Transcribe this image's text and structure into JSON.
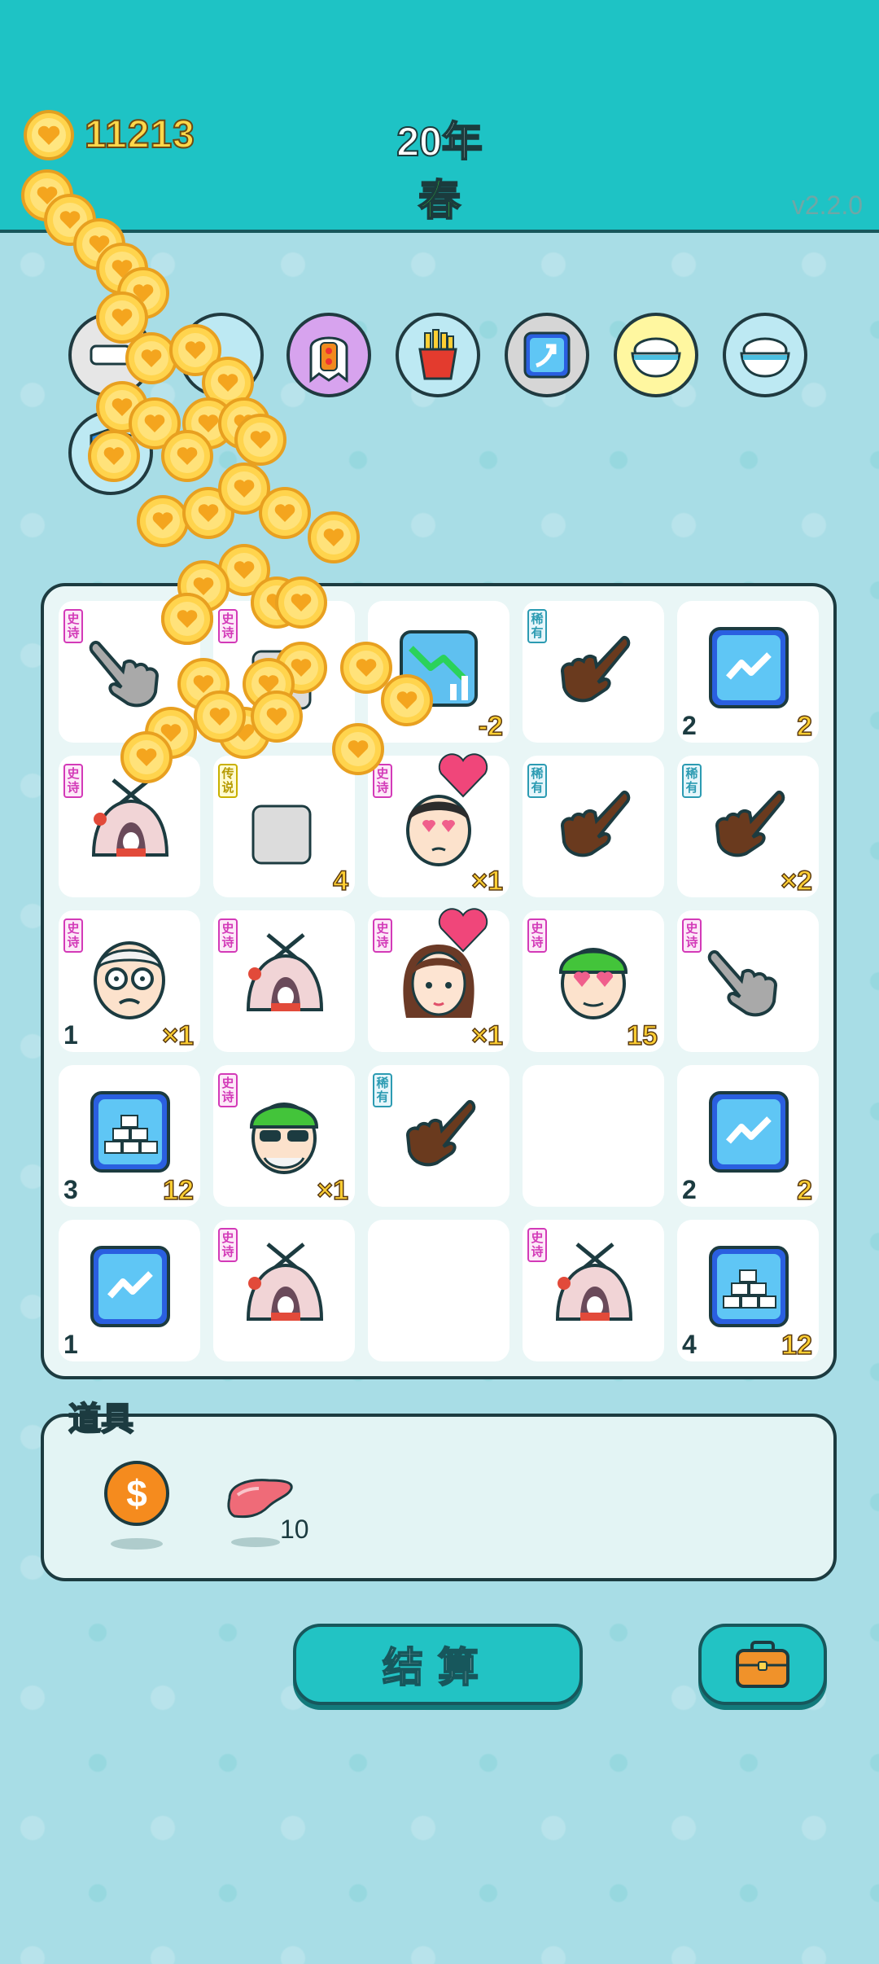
{
  "header": {
    "coins": "11213",
    "year": "20年",
    "season": "春",
    "version": "v2.2.0"
  },
  "items": [
    {
      "name": "dentures-icon",
      "bg": "#e6e6e6"
    },
    {
      "name": "scooter-icon",
      "bg": "#bde9f3"
    },
    {
      "name": "ghost-traffic-light-icon",
      "bg": "#d7a3ee"
    },
    {
      "name": "fries-icon",
      "bg": "#bde9f3"
    },
    {
      "name": "arrow-card-icon",
      "bg": "#d6d6d6"
    },
    {
      "name": "rice-bowl-icon",
      "bg": "#fff7a0"
    },
    {
      "name": "rice-bowl-icon",
      "bg": "#bde9f3"
    },
    {
      "name": "shield-icon",
      "bg": "#bde9f3"
    }
  ],
  "board": [
    {
      "tag": "史诗",
      "tagType": "epic",
      "icon": "pointing-hand-gray-icon",
      "left": "",
      "right": ""
    },
    {
      "tag": "史诗",
      "tagType": "epic",
      "icon": "covered-icon",
      "left": "",
      "right": ""
    },
    {
      "tag": "",
      "tagType": "",
      "icon": "chart-down-icon",
      "left": "",
      "right": "-2"
    },
    {
      "tag": "稀有",
      "tagType": "rare",
      "icon": "pointing-hand-brown-icon",
      "left": "",
      "right": ""
    },
    {
      "tag": "",
      "tagType": "",
      "icon": "trend-card-icon",
      "left": "2",
      "right": "2"
    },
    {
      "tag": "史诗",
      "tagType": "epic",
      "icon": "rabbit-house-icon",
      "left": "",
      "right": ""
    },
    {
      "tag": "传说",
      "tagType": "legend",
      "icon": "covered-icon",
      "left": "",
      "right": "4"
    },
    {
      "tag": "史诗",
      "tagType": "epic",
      "icon": "love-guy-icon",
      "left": "",
      "right": "×1"
    },
    {
      "tag": "稀有",
      "tagType": "rare",
      "icon": "pointing-hand-brown-icon",
      "left": "",
      "right": ""
    },
    {
      "tag": "稀有",
      "tagType": "rare",
      "icon": "pointing-hand-brown-icon",
      "left": "",
      "right": "×2"
    },
    {
      "tag": "史诗",
      "tagType": "epic",
      "icon": "old-man-icon",
      "left": "1",
      "right": "×1"
    },
    {
      "tag": "史诗",
      "tagType": "epic",
      "icon": "rabbit-house-icon",
      "left": "",
      "right": ""
    },
    {
      "tag": "史诗",
      "tagType": "epic",
      "icon": "girl-braids-icon",
      "left": "",
      "right": "×1"
    },
    {
      "tag": "史诗",
      "tagType": "epic",
      "icon": "green-hat-love-icon",
      "left": "",
      "right": "15"
    },
    {
      "tag": "史诗",
      "tagType": "epic",
      "icon": "pointing-hand-gray-icon",
      "left": "",
      "right": ""
    },
    {
      "tag": "",
      "tagType": "",
      "icon": "gold-bars-icon",
      "left": "3",
      "right": "12"
    },
    {
      "tag": "史诗",
      "tagType": "epic",
      "icon": "green-hat-sunglasses-icon",
      "left": "",
      "right": "×1"
    },
    {
      "tag": "稀有",
      "tagType": "rare",
      "icon": "pointing-hand-brown-icon",
      "left": "",
      "right": ""
    },
    {
      "tag": "",
      "tagType": "",
      "icon": "",
      "left": "",
      "right": ""
    },
    {
      "tag": "",
      "tagType": "",
      "icon": "trend-card-icon",
      "left": "2",
      "right": "2"
    },
    {
      "tag": "",
      "tagType": "",
      "icon": "trend-card-icon",
      "left": "1",
      "right": ""
    },
    {
      "tag": "史诗",
      "tagType": "epic",
      "icon": "rabbit-house-icon",
      "left": "",
      "right": ""
    },
    {
      "tag": "",
      "tagType": "",
      "icon": "",
      "left": "",
      "right": ""
    },
    {
      "tag": "史诗",
      "tagType": "epic",
      "icon": "rabbit-house-icon",
      "left": "",
      "right": ""
    },
    {
      "tag": "",
      "tagType": "",
      "icon": "gold-bars-icon",
      "left": "4",
      "right": "12"
    }
  ],
  "props": {
    "title": "道具",
    "liver_count": "10"
  },
  "buttons": {
    "settle": "结算"
  }
}
